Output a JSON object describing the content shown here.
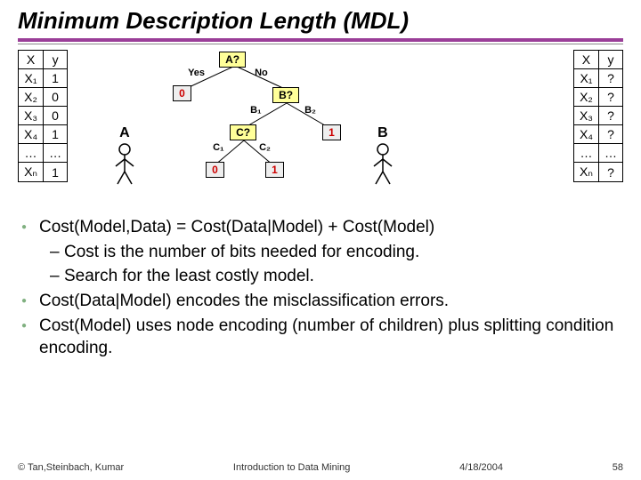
{
  "title": "Minimum Description Length (MDL)",
  "table_left": {
    "headers": [
      "X",
      "y"
    ],
    "rows": [
      [
        "X₁",
        "1"
      ],
      [
        "X₂",
        "0"
      ],
      [
        "X₃",
        "0"
      ],
      [
        "X₄",
        "1"
      ],
      [
        "…",
        "…"
      ],
      [
        "Xₙ",
        "1"
      ]
    ]
  },
  "table_right": {
    "headers": [
      "X",
      "y"
    ],
    "rows": [
      [
        "X₁",
        "?"
      ],
      [
        "X₂",
        "?"
      ],
      [
        "X₃",
        "?"
      ],
      [
        "X₄",
        "?"
      ],
      [
        "…",
        "…"
      ],
      [
        "Xₙ",
        "?"
      ]
    ]
  },
  "tree": {
    "root": "A?",
    "yes": "Yes",
    "no": "No",
    "b_node": "B?",
    "c_node": "C?",
    "b1": "B₁",
    "b2": "B₂",
    "c1": "C₁",
    "c2": "C₂",
    "leaf0a": "0",
    "leaf0b": "0",
    "leaf1a": "1",
    "leaf1b": "1",
    "labelA": "A",
    "labelB": "B"
  },
  "bullets": [
    "Cost(Model,Data) = Cost(Data|Model) + Cost(Model)",
    "Cost is the number of bits needed for encoding.",
    "Search for the least costly model.",
    "Cost(Data|Model) encodes the misclassification errors.",
    "Cost(Model) uses node encoding (number of children) plus splitting condition encoding."
  ],
  "footer": {
    "left": "© Tan,Steinbach, Kumar",
    "center": "Introduction to Data Mining",
    "right_date": "4/18/2004",
    "right_page": "58"
  }
}
